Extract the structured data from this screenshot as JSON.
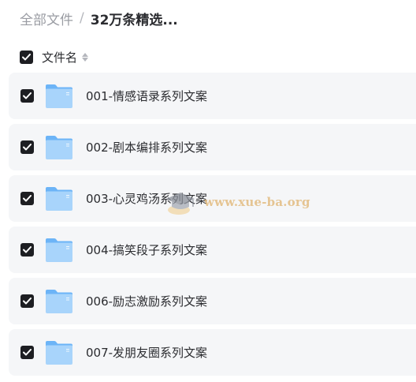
{
  "breadcrumb": {
    "root": "全部文件",
    "separator": "/",
    "current": "32万条精选..."
  },
  "list_header": {
    "checked": true,
    "label": "文件名",
    "sort_icon": "sort-icon"
  },
  "files": [
    {
      "name": "001-情感语录系列文案",
      "checked": true,
      "icon": "folder-icon"
    },
    {
      "name": "002-剧本编排系列文案",
      "checked": true,
      "icon": "folder-icon"
    },
    {
      "name": "003-心灵鸡汤系列文案",
      "checked": true,
      "icon": "folder-icon"
    },
    {
      "name": "004-搞笑段子系列文案",
      "checked": true,
      "icon": "folder-icon"
    },
    {
      "name": "006-励志激励系列文案",
      "checked": true,
      "icon": "folder-icon"
    },
    {
      "name": "007-发朋友圈系列文案",
      "checked": true,
      "icon": "folder-icon"
    }
  ],
  "watermark": {
    "text": "www.xue-ba.org",
    "icon": "graduation-cap-icon"
  },
  "colors": {
    "row_background": "#f5f6f8",
    "checkbox": "#1d1e22",
    "folder_light": "#a8d4fb",
    "folder_dark": "#6cb4f7",
    "breadcrumb_muted": "#9a9ca3",
    "watermark": "#e0b470"
  }
}
